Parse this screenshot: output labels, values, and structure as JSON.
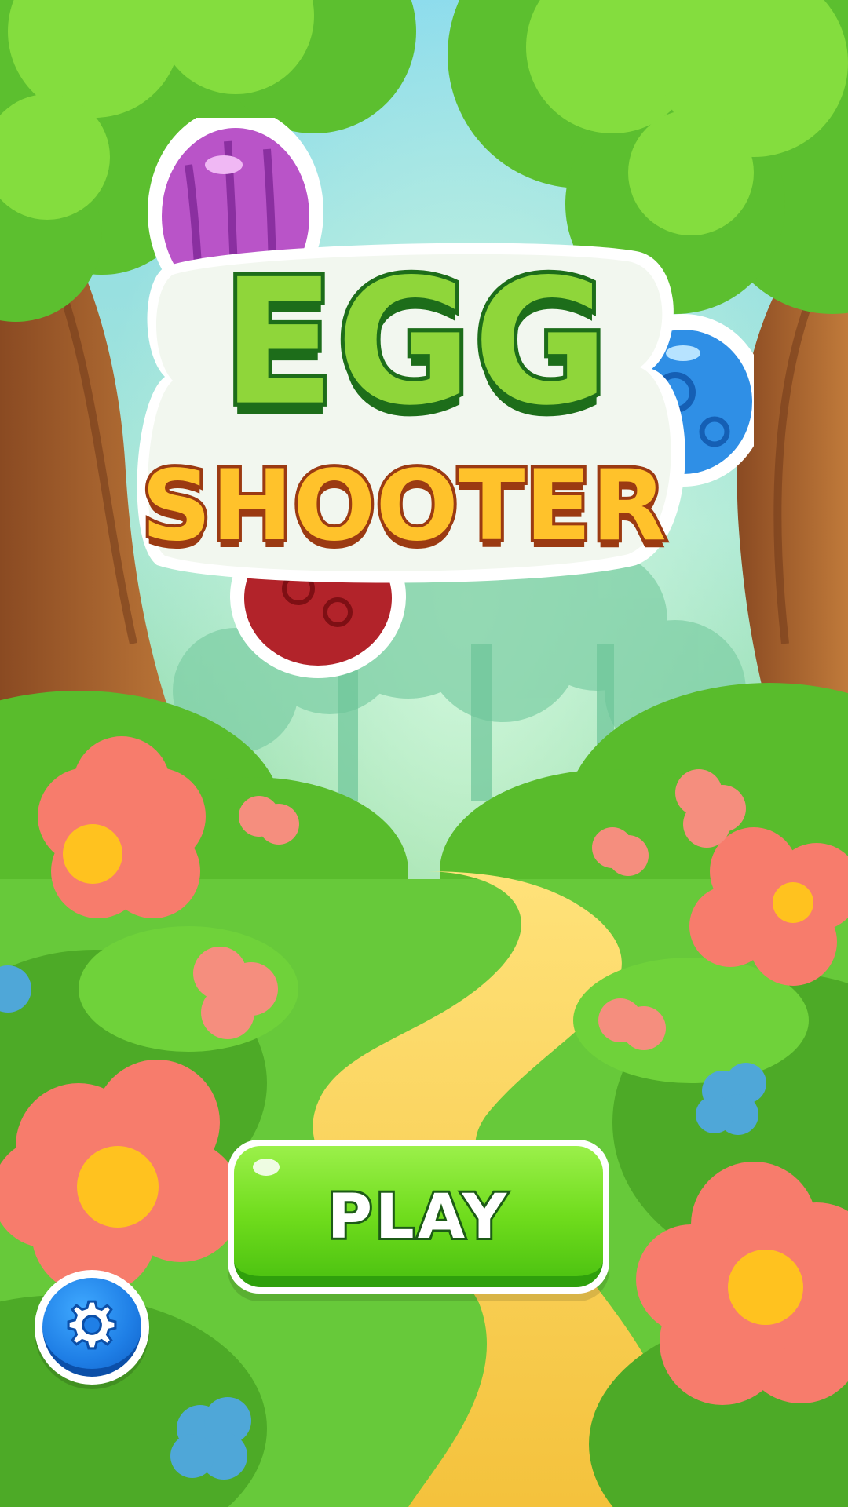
{
  "game": {
    "title_line1": "EGG",
    "title_line2": "SHOOTER"
  },
  "menu": {
    "play_label": "PLAY",
    "settings_icon": "gear-icon"
  },
  "colors": {
    "play_green": "#6fdc1c",
    "settings_blue": "#1f7fe6",
    "title_green": "#8fd63a",
    "title_orange": "#ffc22b"
  }
}
